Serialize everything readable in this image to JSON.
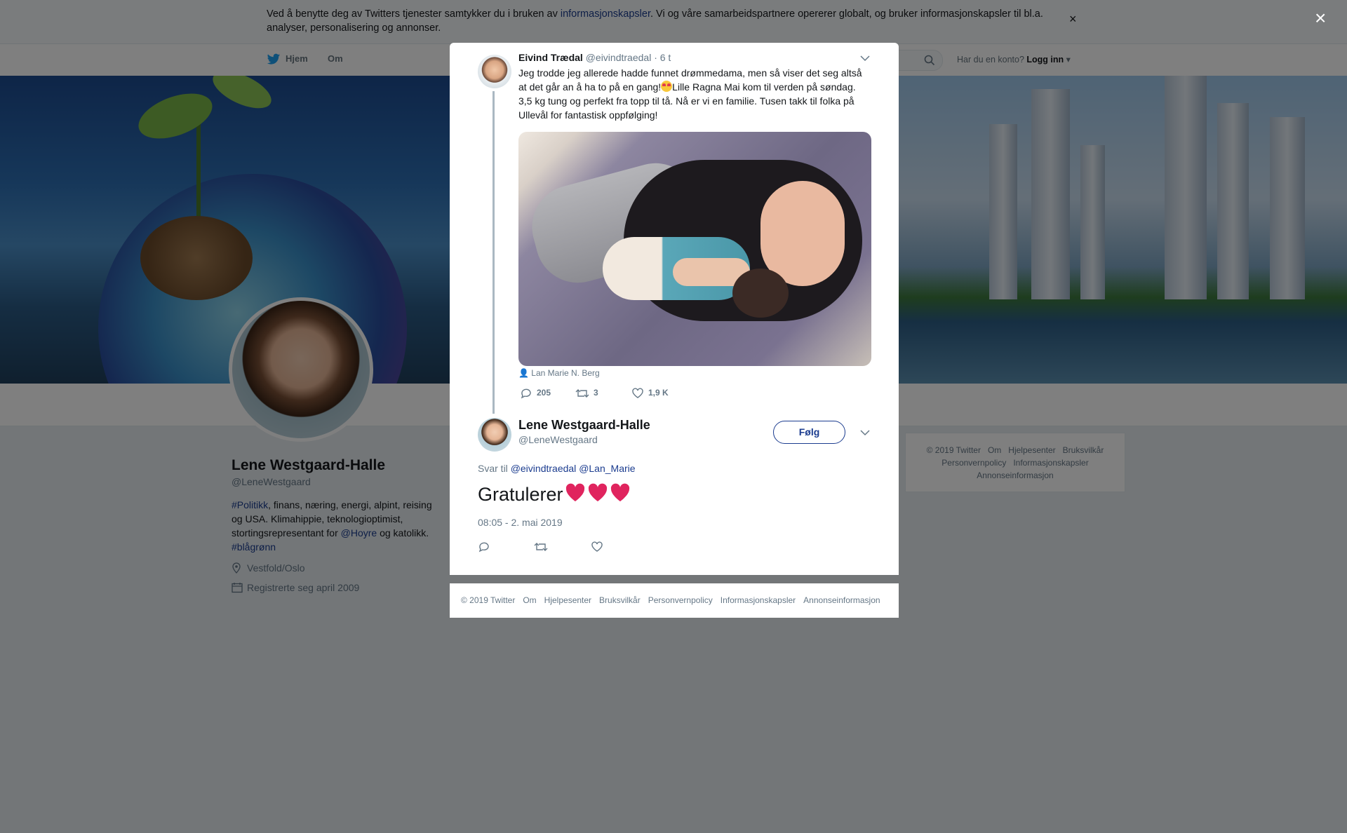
{
  "cookie_bar": {
    "text_before": "Ved å benytte deg av Twitters tjenester samtykker du i bruken av ",
    "link": "informasjonskapsler",
    "text_after": ". Vi og våre samarbeidspartnere opererer globalt, og bruker informasjonskapsler til bl.a. analyser, personalisering og annonser.",
    "close": "×"
  },
  "top_nav": {
    "home": "Hjem",
    "about": "Om",
    "account_prompt": "Har du en konto?",
    "login": "Logg inn"
  },
  "profile": {
    "name": "Lene Westgaard-Halle",
    "handle": "@LeneWestgaard",
    "bio": {
      "tag1": "#Politikk",
      "text1": ", finans, næring, energi, alpint, reising og USA. Klimahippie, teknologioptimist, stortingsrepresentant for ",
      "mention": "@Hoyre",
      "text2": " og katolikk. ",
      "tag2": "#blågrønn"
    },
    "location": "Vestfold/Oslo",
    "joined": "Registrerte seg april 2009"
  },
  "right_footer": {
    "links": [
      "© 2019 Twitter",
      "Om",
      "Hjelpesenter",
      "Bruksvilkår",
      "Personvernpolicy",
      "Informasjonskapsler",
      "Annonseinformasjon"
    ]
  },
  "overlay": {
    "close": "×"
  },
  "tweet_parent": {
    "name": "Eivind Trædal",
    "handle": "@eivindtraedal",
    "time": "· 6 t",
    "text_part1": "Jeg trodde jeg allerede hadde funnet drømmedama, men så viser det seg altså at det går an å ha to på en gang!",
    "text_part2": "Lille Ragna Mai kom til verden på søndag. 3,5 kg tung og perfekt fra topp til tå. Nå er vi en familie. Tusen takk til folka på Ullevål for fantastisk oppfølging!",
    "photo_tag": "Lan Marie N. Berg",
    "replies": "205",
    "retweets": "3",
    "likes": "1,9 K"
  },
  "tweet_main": {
    "name": "Lene Westgaard-Halle",
    "handle": "@LeneWestgaard",
    "follow": "Følg",
    "reply_to_label": "Svar til ",
    "reply_to_1": "@eivindtraedal",
    "reply_to_2": "@Lan_Marie",
    "text": "Gratulerer",
    "date": "08:05 - 2. mai 2019"
  },
  "modal_footer": {
    "links": [
      "© 2019 Twitter",
      "Om",
      "Hjelpesenter",
      "Bruksvilkår",
      "Personvernpolicy",
      "Informasjonskapsler",
      "Annonseinformasjon"
    ]
  },
  "colors": {
    "link": "#1b3c8f",
    "heart": "#e0245e",
    "twitter_blue": "#1da1f2"
  }
}
